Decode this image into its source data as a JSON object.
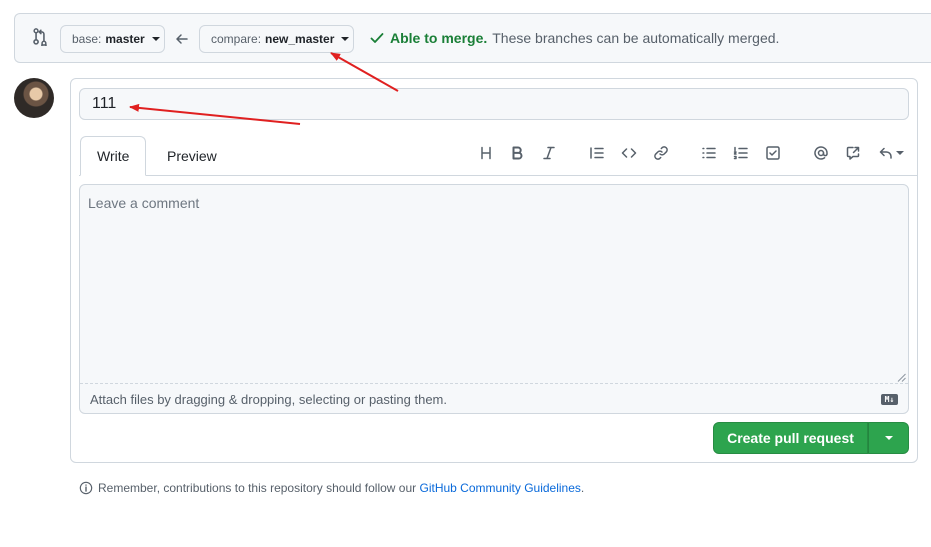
{
  "compare_bar": {
    "base_label": "base:",
    "base_branch": "master",
    "compare_label": "compare:",
    "compare_branch": "new_master",
    "merge_ok": "Able to merge.",
    "merge_desc": "These branches can be automatically merged."
  },
  "form": {
    "title_value": "111",
    "tabs": {
      "write": "Write",
      "preview": "Preview"
    },
    "toolbar_icons": [
      "heading-icon",
      "bold-icon",
      "italic-icon",
      "quote-icon",
      "code-icon",
      "link-icon",
      "bulleted-list-icon",
      "numbered-list-icon",
      "task-list-icon",
      "mention-icon",
      "cross-reference-icon",
      "saved-replies-icon"
    ],
    "comment_placeholder": "Leave a comment",
    "attach_text": "Attach files by dragging & dropping, selecting or pasting them.",
    "markdown_badge": "M↓",
    "create_button": "Create pull request"
  },
  "footer": {
    "note_prefix": "Remember, contributions to this repository should follow our ",
    "note_link": "GitHub Community Guidelines",
    "note_suffix": "."
  },
  "colors": {
    "accent_green": "#2da44e",
    "merge_green": "#1a7f37",
    "link_blue": "#0969da",
    "annotation_red": "#e02020"
  }
}
